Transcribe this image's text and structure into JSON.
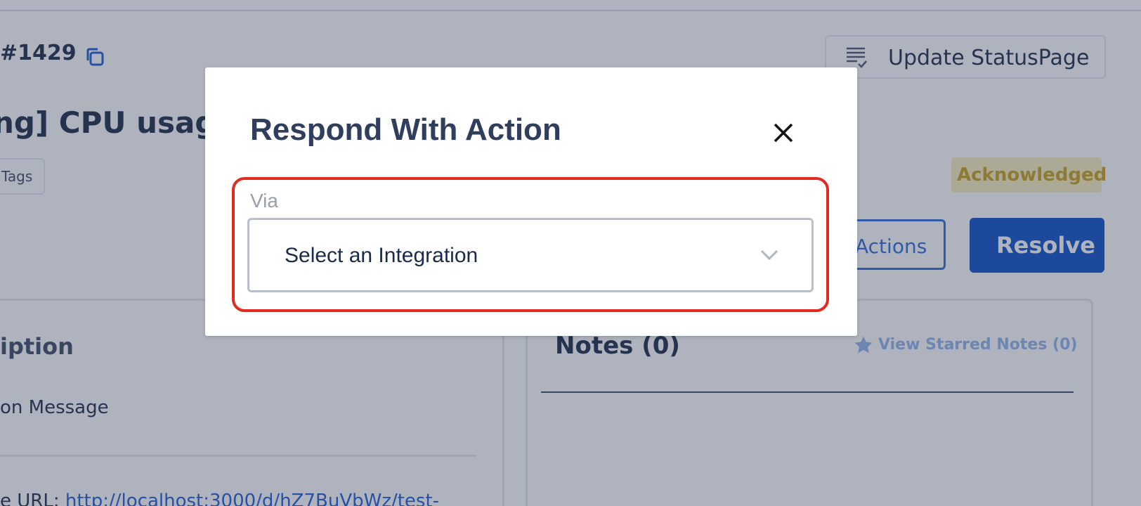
{
  "background": {
    "incident_id": "#1429",
    "incident_title": "ng] CPU usag",
    "tags_label": "Tags",
    "update_statuspage_label": "Update StatusPage",
    "status_badge": "Acknowledged",
    "actions_label": "Actions",
    "resolve_label": "Resolve",
    "description_heading": "iption",
    "description_sub": "on Message",
    "description_url_prefix": "e URL: ",
    "description_url_link": "http://localhost:3000/d/hZ7BuVbWz/test-",
    "notes_heading": "Notes (0)",
    "starred_notes_label": "View Starred Notes (0)"
  },
  "modal": {
    "title": "Respond With Action",
    "field_label": "Via",
    "select_placeholder": "Select an Integration"
  },
  "colors": {
    "primary": "#0d4fc9",
    "highlight_border": "#e22a1e",
    "badge_bg": "#fbf0bf",
    "badge_text": "#c6a21d"
  },
  "icons": {
    "copy": "copy-icon",
    "statuspage": "document-check-icon",
    "star": "star-icon",
    "close": "close-icon",
    "chevron": "chevron-down-icon"
  }
}
